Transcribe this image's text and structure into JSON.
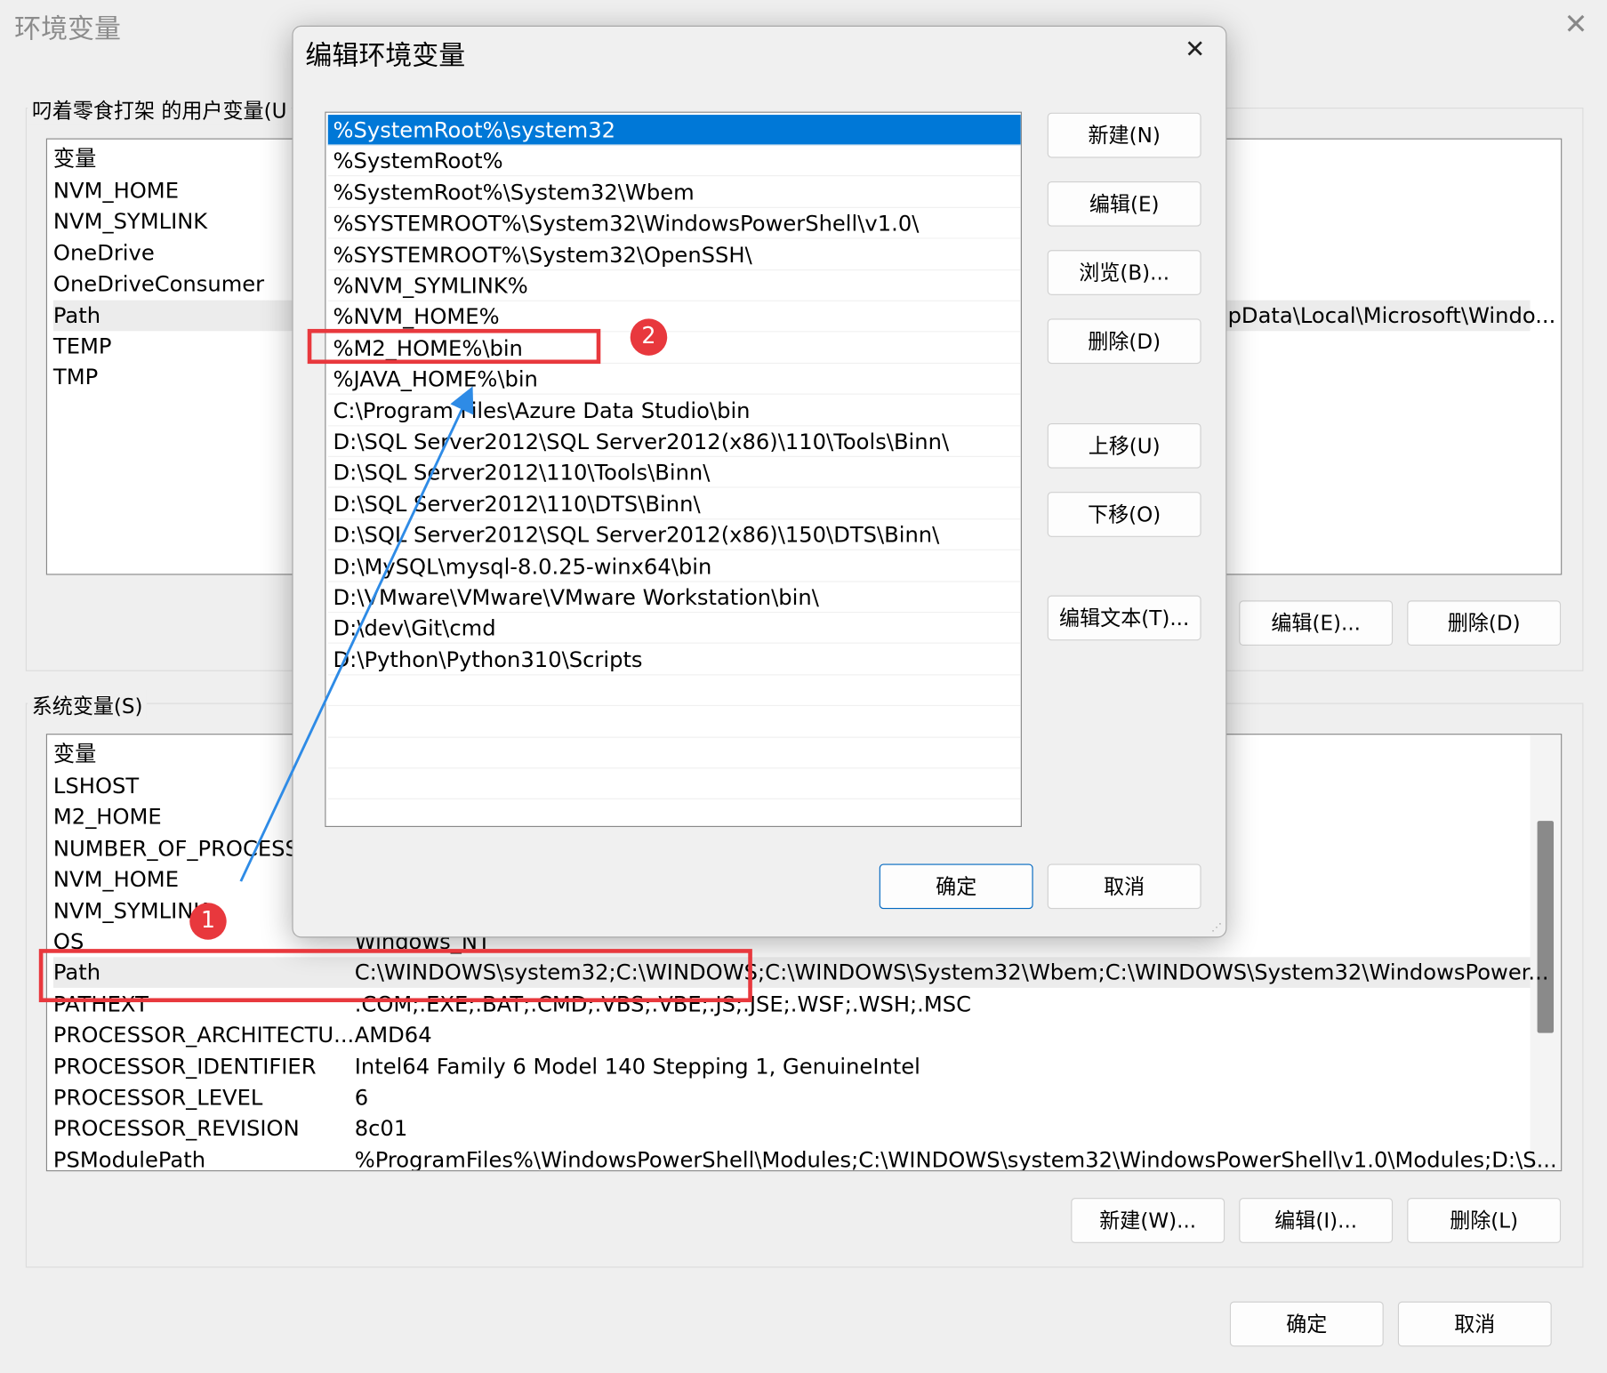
{
  "window": {
    "title": "环境变量",
    "close_icon": "close-icon"
  },
  "user_vars": {
    "group_label": "叼着零食打架 的用户变量(U",
    "header": "变量",
    "rows": [
      {
        "name": "NVM_HOME",
        "value": ""
      },
      {
        "name": "NVM_SYMLINK",
        "value": ""
      },
      {
        "name": "OneDrive",
        "value": ""
      },
      {
        "name": "OneDriveConsumer",
        "value": ""
      },
      {
        "name": "Path",
        "value": "pData\\Local\\Microsoft\\Windo..."
      },
      {
        "name": "TEMP",
        "value": ""
      },
      {
        "name": "TMP",
        "value": ""
      }
    ],
    "buttons": {
      "edit": "编辑(E)...",
      "delete": "删除(D)"
    }
  },
  "system_vars": {
    "group_label": "系统变量(S)",
    "header": "变量",
    "rows": [
      {
        "name": "LSHOST",
        "value": ""
      },
      {
        "name": "M2_HOME",
        "value": ""
      },
      {
        "name": "NUMBER_OF_PROCESS",
        "value": ""
      },
      {
        "name": "NVM_HOME",
        "value": ""
      },
      {
        "name": "NVM_SYMLINK",
        "value": ""
      },
      {
        "name": "OS",
        "value": "Windows_NT"
      },
      {
        "name": "Path",
        "value": "C:\\WINDOWS\\system32;C:\\WINDOWS;C:\\WINDOWS\\System32\\Wbem;C:\\WINDOWS\\System32\\WindowsPower..."
      },
      {
        "name": "PATHEXT",
        "value": ".COM;.EXE;.BAT;.CMD;.VBS;.VBE;.JS;.JSE;.WSF;.WSH;.MSC"
      },
      {
        "name": "PROCESSOR_ARCHITECTU...",
        "value": "AMD64"
      },
      {
        "name": "PROCESSOR_IDENTIFIER",
        "value": "Intel64 Family 6 Model 140 Stepping 1, GenuineIntel"
      },
      {
        "name": "PROCESSOR_LEVEL",
        "value": "6"
      },
      {
        "name": "PROCESSOR_REVISION",
        "value": "8c01"
      },
      {
        "name": "PSModulePath",
        "value": "%ProgramFiles%\\WindowsPowerShell\\Modules;C:\\WINDOWS\\system32\\WindowsPowerShell\\v1.0\\Modules;D:\\S..."
      }
    ],
    "buttons": {
      "new": "新建(W)...",
      "edit": "编辑(I)...",
      "delete": "删除(L)"
    }
  },
  "footer": {
    "ok": "确定",
    "cancel": "取消"
  },
  "dialog": {
    "title": "编辑环境变量",
    "entries": [
      "%SystemRoot%\\system32",
      "%SystemRoot%",
      "%SystemRoot%\\System32\\Wbem",
      "%SYSTEMROOT%\\System32\\WindowsPowerShell\\v1.0\\",
      "%SYSTEMROOT%\\System32\\OpenSSH\\",
      "%NVM_SYMLINK%",
      "%NVM_HOME%",
      "%M2_HOME%\\bin",
      "%JAVA_HOME%\\bin",
      "C:\\Program Files\\Azure Data Studio\\bin",
      "D:\\SQL Server2012\\SQL Server2012(x86)\\110\\Tools\\Binn\\",
      "D:\\SQL Server2012\\110\\Tools\\Binn\\",
      "D:\\SQL Server2012\\110\\DTS\\Binn\\",
      "D:\\SQL Server2012\\SQL Server2012(x86)\\150\\DTS\\Binn\\",
      "D:\\MySQL\\mysql-8.0.25-winx64\\bin",
      "D:\\VMware\\VMware\\VMware Workstation\\bin\\",
      "D:\\dev\\Git\\cmd",
      "D:\\Python\\Python310\\Scripts"
    ],
    "selected_index": 0,
    "buttons": {
      "new": "新建(N)",
      "edit": "编辑(E)",
      "browse": "浏览(B)...",
      "delete": "删除(D)",
      "move_up": "上移(U)",
      "move_down": "下移(O)",
      "edit_text": "编辑文本(T)...",
      "ok": "确定",
      "cancel": "取消"
    }
  },
  "annotations": {
    "badge1": "1",
    "badge2": "2",
    "highlight_color": "#e8383d",
    "arrow_color": "#2e8be6"
  },
  "colors": {
    "selection": "#0078d7",
    "primary_border": "#0067c0"
  }
}
